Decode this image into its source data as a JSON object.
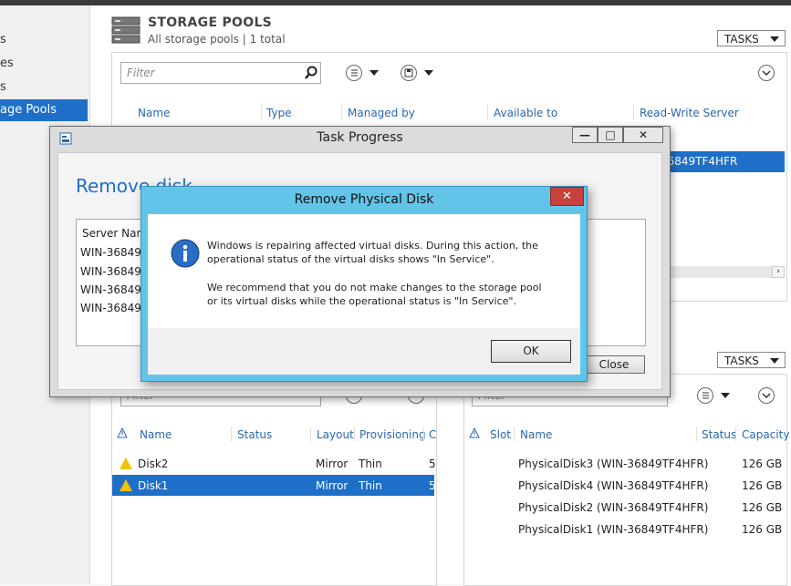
{
  "nav": {
    "items": [
      {
        "label": "s"
      },
      {
        "label": "es"
      },
      {
        "label": "s"
      },
      {
        "label": "age Pools"
      }
    ]
  },
  "storage_pools": {
    "title": "STORAGE POOLS",
    "subtitle": "All storage pools | 1 total",
    "tasks_label": "TASKS",
    "filter_placeholder": "Filter",
    "columns": [
      "Name",
      "Type",
      "Managed by",
      "Available to",
      "Read-Write Server"
    ],
    "selected_row_text": "36849TF4HFR"
  },
  "virtual_disks": {
    "filter_placeholder": "Filter",
    "columns": [
      "Name",
      "Status",
      "Layout",
      "Provisioning",
      "C"
    ],
    "rows": [
      {
        "name": "Disk2",
        "layout": "Mirror",
        "provisioning": "Thin",
        "cap": "5"
      },
      {
        "name": "Disk1",
        "layout": "Mirror",
        "provisioning": "Thin",
        "cap": "5"
      }
    ]
  },
  "physical_disks": {
    "tasks_label": "TASKS",
    "filter_placeholder": "Filter",
    "columns": [
      "Slot",
      "Name",
      "Status",
      "Capacity"
    ],
    "rows": [
      {
        "name": "PhysicalDisk3 (WIN-36849TF4HFR)",
        "capacity": "126 GB"
      },
      {
        "name": "PhysicalDisk4 (WIN-36849TF4HFR)",
        "capacity": "126 GB"
      },
      {
        "name": "PhysicalDisk2 (WIN-36849TF4HFR)",
        "capacity": "126 GB"
      },
      {
        "name": "PhysicalDisk1 (WIN-36849TF4HFR)",
        "capacity": "126 GB"
      }
    ]
  },
  "task_progress": {
    "window_title": "Task Progress",
    "heading": "Remove disk",
    "server_col": "Server Name",
    "servers": [
      "WIN-36849T",
      "WIN-36849T",
      "WIN-36849T",
      "WIN-36849T"
    ],
    "close_label": "Close"
  },
  "message_box": {
    "title": "Remove Physical Disk",
    "paragraph1": "Windows is repairing affected virtual disks. During this action, the operational status of the virtual disks shows \"In Service\".",
    "paragraph2": "We recommend that you do not make changes to the storage pool or its virtual disks while the operational status is \"In Service\".",
    "ok_label": "OK"
  },
  "colors": {
    "accent": "#1e6fc7",
    "msgbox_title": "#62c4e8",
    "close_red": "#c8413b"
  }
}
